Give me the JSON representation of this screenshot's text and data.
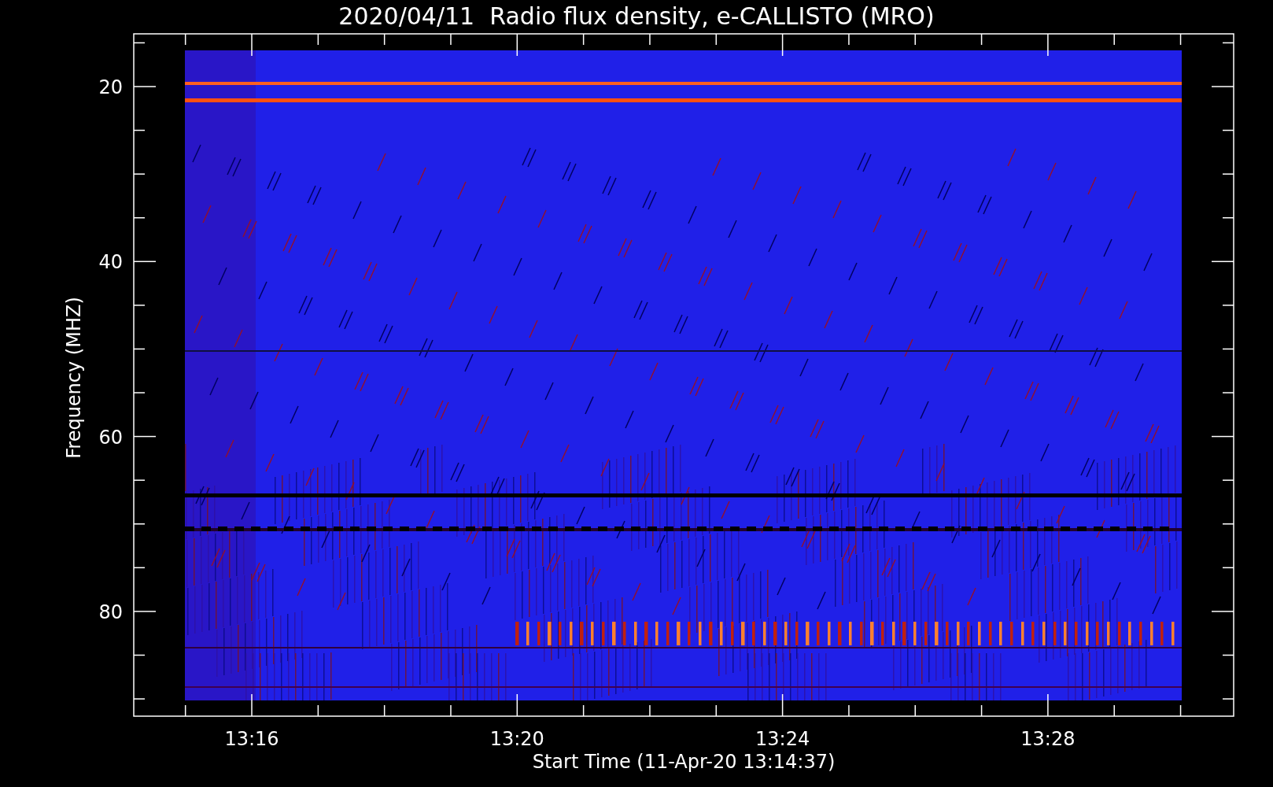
{
  "title": "2020/04/11  Radio flux density, e-CALLISTO (MRO)",
  "y_axis": {
    "label": "Frequency (MHZ)",
    "ticks": [
      "20",
      "40",
      "60",
      "80"
    ]
  },
  "x_axis": {
    "label": "Start Time (11-Apr-20 13:14:37)",
    "ticks": [
      "13:16",
      "13:20",
      "13:24",
      "13:28"
    ]
  }
}
